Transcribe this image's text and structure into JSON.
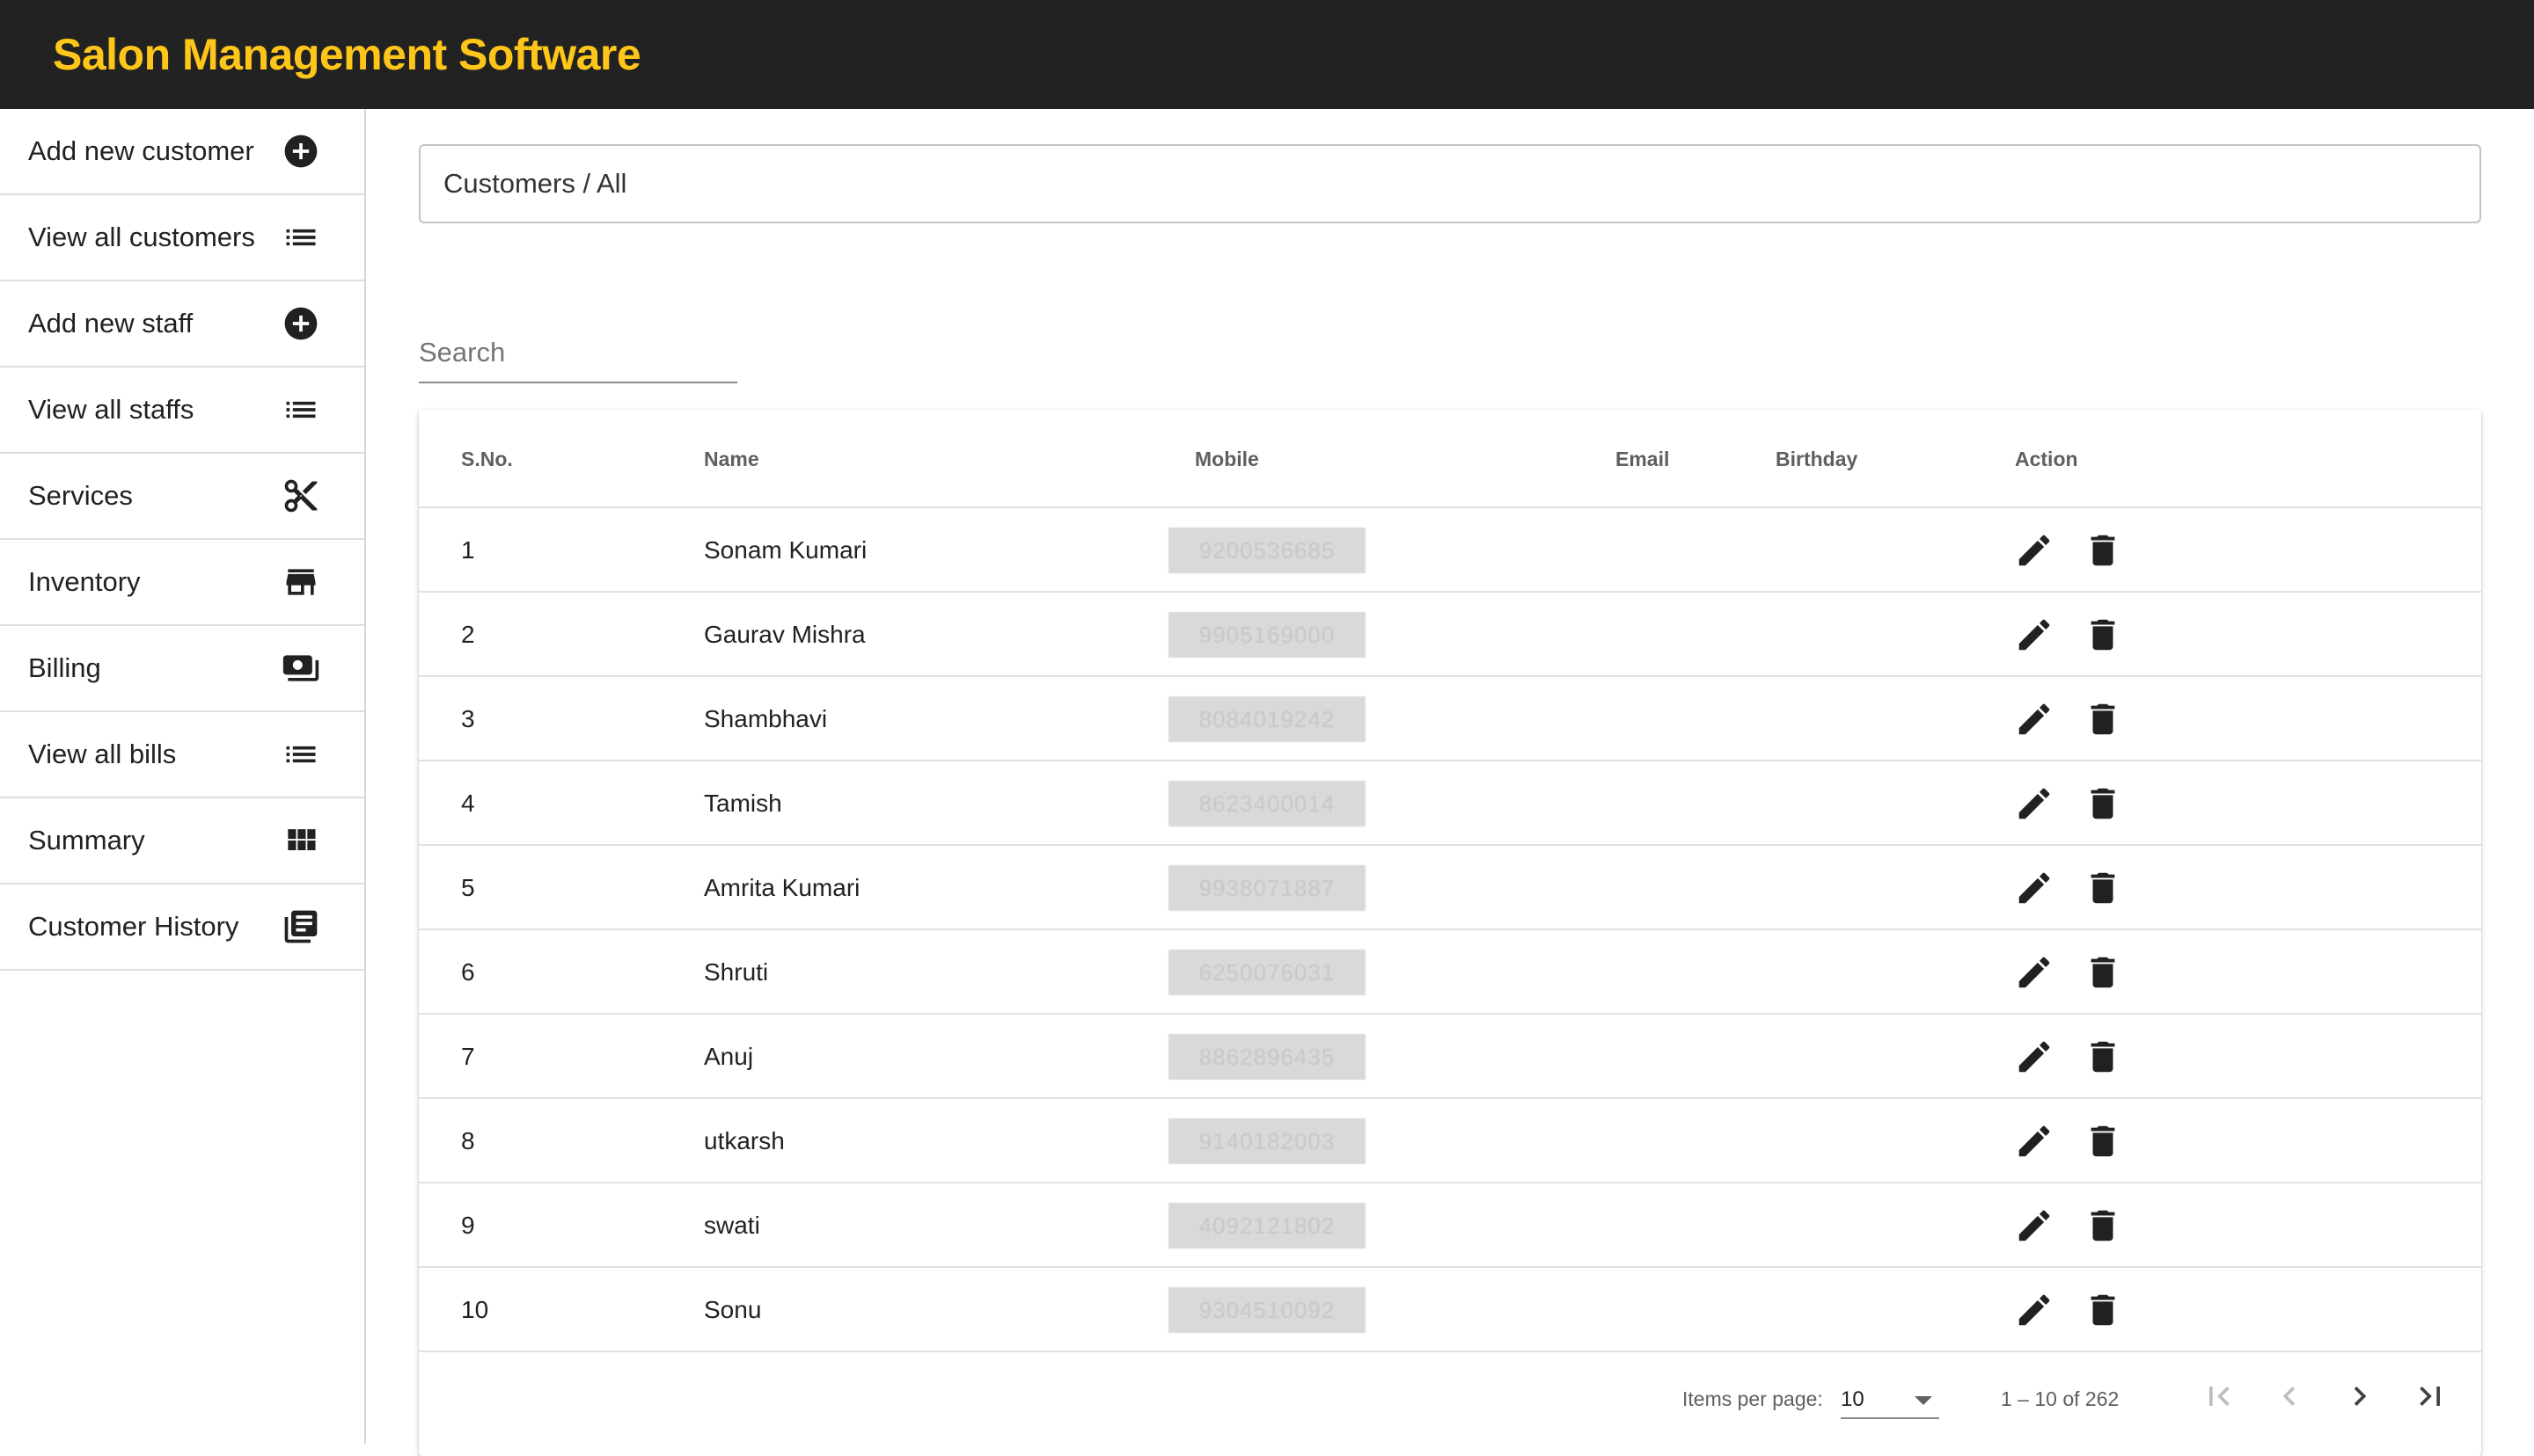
{
  "app": {
    "title": "Salon Management Software",
    "accent_color": "#ffc61a",
    "header_bg": "#222222"
  },
  "sidebar": {
    "items": [
      {
        "label": "Add new customer",
        "icon": "add-circle-icon"
      },
      {
        "label": "View all customers",
        "icon": "list-icon"
      },
      {
        "label": "Add new staff",
        "icon": "add-circle-icon"
      },
      {
        "label": "View all staffs",
        "icon": "list-icon"
      },
      {
        "label": "Services",
        "icon": "scissors-icon"
      },
      {
        "label": "Inventory",
        "icon": "store-icon"
      },
      {
        "label": "Billing",
        "icon": "cash-icon"
      },
      {
        "label": "View all bills",
        "icon": "list-icon"
      },
      {
        "label": "Summary",
        "icon": "grid-icon"
      },
      {
        "label": "Customer History",
        "icon": "history-icon"
      }
    ]
  },
  "breadcrumb": {
    "text": "Customers / All"
  },
  "search": {
    "placeholder": "Search",
    "value": ""
  },
  "table": {
    "headers": {
      "sno": "S.No.",
      "name": "Name",
      "mobile": "Mobile",
      "email": "Email",
      "birthday": "Birthday",
      "action": "Action"
    },
    "rows": [
      {
        "sno": "1",
        "name": "Sonam Kumari",
        "mobile": "9200536685",
        "email": "",
        "birthday": ""
      },
      {
        "sno": "2",
        "name": "Gaurav Mishra",
        "mobile": "9905169000",
        "email": "",
        "birthday": ""
      },
      {
        "sno": "3",
        "name": "Shambhavi",
        "mobile": "8084019242",
        "email": "",
        "birthday": ""
      },
      {
        "sno": "4",
        "name": "Tamish",
        "mobile": "8623400014",
        "email": "",
        "birthday": ""
      },
      {
        "sno": "5",
        "name": "Amrita Kumari",
        "mobile": "9938071887",
        "email": "",
        "birthday": ""
      },
      {
        "sno": "6",
        "name": "Shruti",
        "mobile": "6250076031",
        "email": "",
        "birthday": ""
      },
      {
        "sno": "7",
        "name": "Anuj",
        "mobile": "8862896435",
        "email": "",
        "birthday": ""
      },
      {
        "sno": "8",
        "name": "utkarsh",
        "mobile": "9140182003",
        "email": "",
        "birthday": ""
      },
      {
        "sno": "9",
        "name": "swati",
        "mobile": "4092121802",
        "email": "",
        "birthday": ""
      },
      {
        "sno": "10",
        "name": "Sonu",
        "mobile": "9304510092",
        "email": "",
        "birthday": ""
      }
    ],
    "row_actions": {
      "edit_icon": "pencil-icon",
      "delete_icon": "trash-icon"
    }
  },
  "paginator": {
    "items_per_page_label": "Items per page:",
    "items_per_page_value": "10",
    "range_label": "1 – 10 of 262"
  }
}
